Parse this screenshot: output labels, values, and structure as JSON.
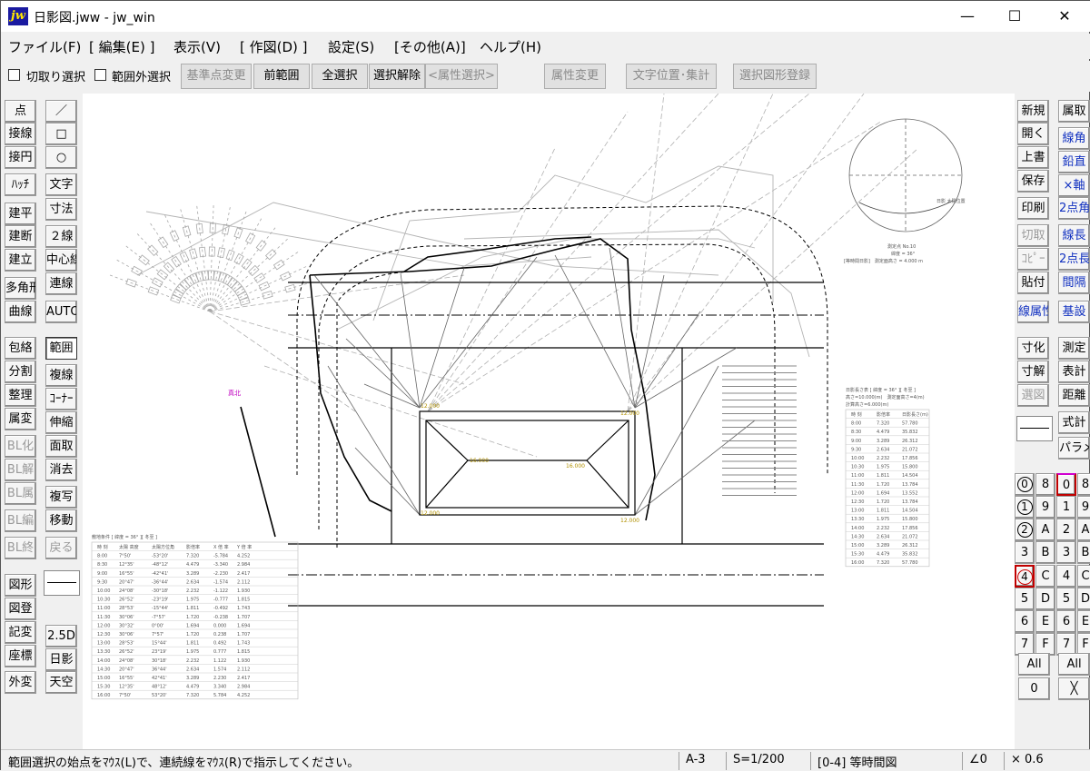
{
  "window": {
    "title": "日影図.jww - jw_win",
    "icon_label": "jw",
    "minimize": "—",
    "maximize": "☐",
    "close": "✕"
  },
  "menu": [
    "ファイル(F)",
    "[ 編集(E) ]",
    "表示(V)",
    "[ 作図(D) ]",
    "設定(S)",
    "[その他(A)]",
    "ヘルプ(H)"
  ],
  "toolbar": {
    "crop_select": "切取り選択",
    "out_of_range": "範囲外選択",
    "base_point": "基準点変更",
    "prev_range": "前範囲",
    "select_all": "全選択",
    "deselect": "選択解除",
    "attr_select": "<属性選択>",
    "attr_change": "属性変更",
    "text_pos": "文字位置･集計",
    "register": "選択図形登録"
  },
  "left_tools": {
    "col1": [
      "点",
      "接線",
      "接円",
      "ﾊｯﾁ",
      "建平",
      "建断",
      "建立",
      "多角形",
      "曲線",
      "包絡",
      "分割",
      "整理",
      "属変",
      "BL化",
      "BL解",
      "BL属",
      "BL編",
      "BL終",
      "図形",
      "図登",
      "記変",
      "座標",
      "外変"
    ],
    "col2": [
      "／",
      "□",
      "○",
      "文字",
      "寸法",
      "２線",
      "中心線",
      "連線",
      "AUTO",
      "範囲",
      "複線",
      "ｺｰﾅｰ",
      "伸縮",
      "面取",
      "消去",
      "複写",
      "移動",
      "戻る",
      "2.5D",
      "日影",
      "天空"
    ]
  },
  "right_tools": {
    "col1": [
      "新規",
      "開く",
      "上書",
      "保存",
      "印刷",
      "切取",
      "ｺﾋﾟｰ",
      "貼付",
      "線属性",
      "寸化",
      "寸解",
      "選図",
      "式計"
    ],
    "col2": [
      "属取",
      "線角",
      "鉛直",
      "×軸",
      "2点角",
      "線長",
      "2点長",
      "間隔",
      "基設",
      "測定",
      "表計",
      "距離",
      "パラメ"
    ],
    "layer_group": [
      "0",
      "1",
      "2",
      "3",
      "4",
      "5",
      "6",
      "7"
    ],
    "layer": [
      "8",
      "9",
      "A",
      "B",
      "C",
      "D",
      "E",
      "F"
    ],
    "layer2_a": [
      "0",
      "1",
      "2",
      "3",
      "4",
      "5",
      "6",
      "7"
    ],
    "layer2_b": [
      "8",
      "9",
      "A",
      "B",
      "C",
      "D",
      "E",
      "F"
    ],
    "all": "All",
    "zero": "0",
    "cross": "╳"
  },
  "drawing": {
    "table_left_title": "敷地条件 [ 緯度 = 36° ][ 冬至 ]",
    "table_left_header": [
      "時 刻",
      "太陽 高度",
      "太陽方位角",
      "影倍率",
      "X 倍 率",
      "Y 倍 率"
    ],
    "table_left_rows": [
      [
        "8:00",
        "7°50'",
        "-53°20'",
        "7.320",
        "-5.784",
        "4.252"
      ],
      [
        "8:30",
        "12°35'",
        "-48°12'",
        "4.479",
        "-3.340",
        "2.984"
      ],
      [
        "9:00",
        "16°55'",
        "-42°41'",
        "3.289",
        "-2.230",
        "2.417"
      ],
      [
        "9:30",
        "20°47'",
        "-36°44'",
        "2.634",
        "-1.574",
        "2.112"
      ],
      [
        "10:00",
        "24°08'",
        "-30°18'",
        "2.232",
        "-1.122",
        "1.930"
      ],
      [
        "10:30",
        "26°52'",
        "-23°19'",
        "1.975",
        "-0.777",
        "1.815"
      ],
      [
        "11:00",
        "28°53'",
        "-15°44'",
        "1.811",
        "-0.492",
        "1.743"
      ],
      [
        "11:30",
        "30°06'",
        "-7°57'",
        "1.720",
        "-0.238",
        "1.707"
      ],
      [
        "12:00",
        "30°32'",
        "0°00'",
        "1.694",
        "0.000",
        "1.694"
      ],
      [
        "12:30",
        "30°06'",
        "7°57'",
        "1.720",
        "0.238",
        "1.707"
      ],
      [
        "13:00",
        "28°53'",
        "15°44'",
        "1.811",
        "0.492",
        "1.743"
      ],
      [
        "13:30",
        "26°52'",
        "23°19'",
        "1.975",
        "0.777",
        "1.815"
      ],
      [
        "14:00",
        "24°08'",
        "30°18'",
        "2.232",
        "1.122",
        "1.930"
      ],
      [
        "14:30",
        "20°47'",
        "36°44'",
        "2.634",
        "1.574",
        "2.112"
      ],
      [
        "15:00",
        "16°55'",
        "42°41'",
        "3.289",
        "2.230",
        "2.417"
      ],
      [
        "15:30",
        "12°35'",
        "48°12'",
        "4.479",
        "3.340",
        "2.984"
      ],
      [
        "16:00",
        "7°50'",
        "53°20'",
        "7.320",
        "5.784",
        "4.252"
      ]
    ],
    "table_right_title": "日影長さ表 [ 緯度 = 36° ][ 冬至 ]",
    "table_right_sub1": "高さ=10.000(m)　測定面高さ=4(m)",
    "table_right_sub2": "計算高さ=6.000(m)",
    "table_right_header": [
      "時 刻",
      "影倍率",
      "日影長さ(m)"
    ],
    "table_right_rows": [
      [
        "8:00",
        "7.320",
        "57.780"
      ],
      [
        "8:30",
        "4.479",
        "35.832"
      ],
      [
        "9:00",
        "3.289",
        "26.312"
      ],
      [
        "9:30",
        "2.634",
        "21.072"
      ],
      [
        "10:00",
        "2.232",
        "17.856"
      ],
      [
        "10:30",
        "1.975",
        "15.800"
      ],
      [
        "11:00",
        "1.811",
        "14.504"
      ],
      [
        "11:30",
        "1.720",
        "13.784"
      ],
      [
        "12:00",
        "1.694",
        "13.552"
      ],
      [
        "12:30",
        "1.720",
        "13.784"
      ],
      [
        "13:00",
        "1.811",
        "14.504"
      ],
      [
        "13:30",
        "1.975",
        "15.800"
      ],
      [
        "14:00",
        "2.232",
        "17.856"
      ],
      [
        "14:30",
        "2.634",
        "21.072"
      ],
      [
        "15:00",
        "3.289",
        "26.312"
      ],
      [
        "15:30",
        "4.479",
        "35.832"
      ],
      [
        "16:00",
        "7.320",
        "57.780"
      ]
    ],
    "circle_text1": "測定点 No.10",
    "circle_text2": "緯度 = 36°",
    "circle_text3": "[等時間日影]　測定面高さ = 4.000 m",
    "circle_label": "日影 太陽位置",
    "height_tl": "12.000",
    "height_tr": "12.000",
    "height_ml": "16.000",
    "height_mr": "16.000",
    "height_bl": "12.000",
    "height_br": "12.000",
    "magenta_label": "真北"
  },
  "status": {
    "message": "範囲選択の始点をﾏｳｽ(L)で、連続線をﾏｳｽ(R)で指示してください。",
    "paper": "A-3",
    "scale": "S=1/200",
    "layer": "[0-4] 等時間図",
    "angle": "∠0",
    "zoom": "× 0.6"
  }
}
